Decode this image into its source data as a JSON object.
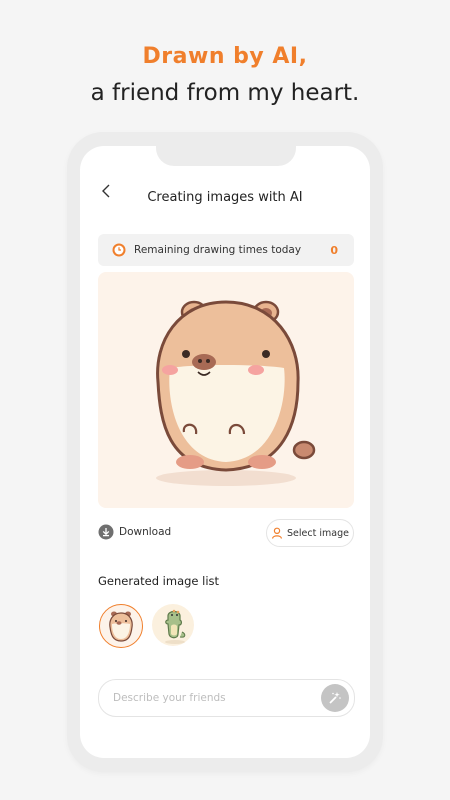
{
  "headline": {
    "line1": "Drawn by AI,",
    "line2": "a friend from my heart."
  },
  "header": {
    "back_icon": "chevron-left-icon",
    "title": "Creating images with AI"
  },
  "remaining": {
    "icon": "clock-icon",
    "label": "Remaining drawing times today",
    "count": "0"
  },
  "actions": {
    "download_label": "Download",
    "download_icon": "download-icon",
    "select_label": "Select image",
    "select_icon": "user-icon"
  },
  "generated": {
    "title": "Generated image list",
    "items": [
      {
        "name": "capybara-thumbnail",
        "selected": true
      },
      {
        "name": "dinosaur-thumbnail",
        "selected": false
      }
    ]
  },
  "prompt": {
    "placeholder": "Describe your friends",
    "send_icon": "magic-wand-icon"
  },
  "colors": {
    "accent": "#f07f2c",
    "background": "#f5f5f5",
    "image_bg": "#fdf3ea"
  }
}
